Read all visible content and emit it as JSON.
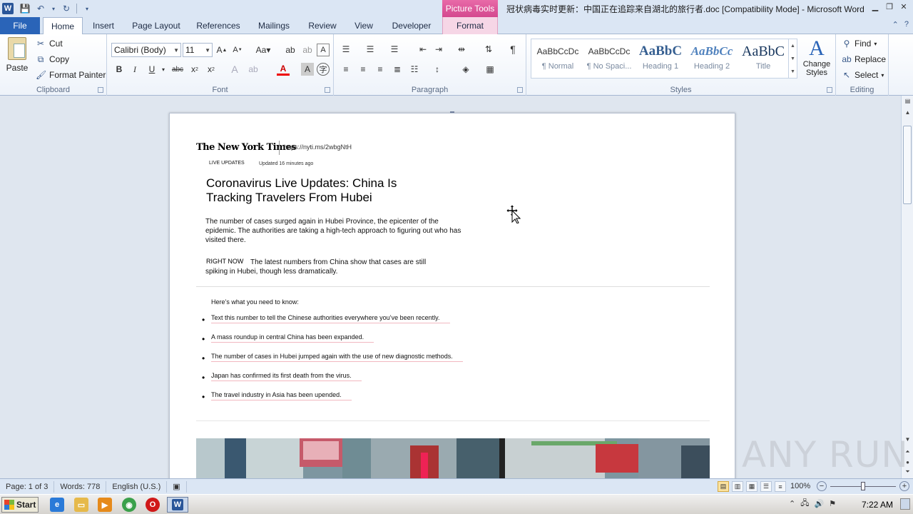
{
  "window": {
    "title": "冠状病毒实时更新：中国正在追踪来自湖北的旅行者.doc [Compatibility Mode]  -  Microsoft Word",
    "picture_tools": "Picture Tools",
    "app_icon": "W"
  },
  "tabs": [
    "File",
    "Home",
    "Insert",
    "Page Layout",
    "References",
    "Mailings",
    "Review",
    "View",
    "Developer",
    "Format"
  ],
  "ribbon": {
    "clipboard": {
      "label": "Clipboard",
      "paste": "Paste",
      "cut": "Cut",
      "copy": "Copy",
      "format_painter": "Format Painter"
    },
    "font": {
      "label": "Font",
      "font_name": "Calibri (Body)",
      "font_size": "11"
    },
    "paragraph": {
      "label": "Paragraph"
    },
    "styles": {
      "label": "Styles",
      "items": [
        {
          "sample": "AaBbCcDc",
          "name": "¶ Normal"
        },
        {
          "sample": "AaBbCcDc",
          "name": "¶ No Spaci..."
        },
        {
          "sample": "AaBbC",
          "name": "Heading 1"
        },
        {
          "sample": "AaBbCc",
          "name": "Heading 2"
        },
        {
          "sample": "AaBbC",
          "name": "Title"
        }
      ],
      "change_styles": "Change Styles"
    },
    "editing": {
      "label": "Editing",
      "find": "Find",
      "replace": "Replace",
      "select": "Select"
    }
  },
  "document": {
    "masthead": "The New York Times",
    "url": "https://nyti.ms/2wbgNtH",
    "live_label": "LIVE UPDATES",
    "updated": "Updated 16 minutes ago",
    "headline": "Coronavirus Live Updates: China Is Tracking Travelers From Hubei",
    "summary": "The number of cases surged again in Hubei Province, the epicenter of the epidemic. The authorities are taking a high-tech approach to figuring out who has visited there.",
    "right_now_label": "RIGHT NOW",
    "right_now_text": "The latest numbers from China show that cases are still spiking in Hubei, though less dramatically.",
    "need_to_know": "Here’s what you need to know:",
    "bullets": [
      "Text this number to tell the Chinese authorities everywhere you’ve been recently.",
      "A mass roundup in central China has been expanded.",
      "The number of cases in Hubei jumped again with the use of new diagnostic methods.",
      "Japan has confirmed its first death from the virus.",
      "The travel industry in Asia has been upended."
    ]
  },
  "statusbar": {
    "page": "Page: 1 of 3",
    "words": "Words: 778",
    "language": "English (U.S.)",
    "zoom": "100%"
  },
  "taskbar": {
    "start": "Start",
    "clock": "7:22 AM"
  },
  "watermark": "ANY RUN"
}
